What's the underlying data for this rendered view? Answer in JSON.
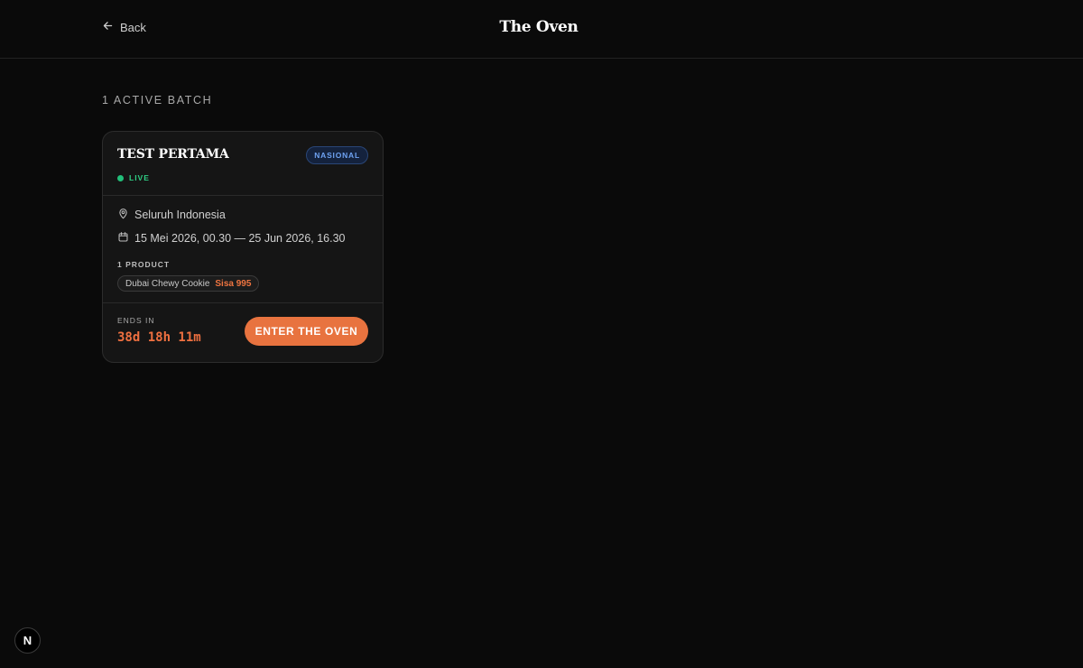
{
  "header": {
    "back_label": "Back",
    "site_title": "The Oven"
  },
  "section": {
    "label": "1 ACTIVE BATCH"
  },
  "batch": {
    "title": "TEST PERTAMA",
    "badge": "NASIONAL",
    "status": "LIVE",
    "location": "Seluruh Indonesia",
    "date_range": "15 Mei 2026, 00.30 — 25 Jun 2026, 16.30",
    "products_label": "1 PRODUCT",
    "products": [
      {
        "name": "Dubai Chewy Cookie",
        "stock": "Sisa 995"
      }
    ],
    "ends_label": "ENDS IN",
    "countdown": "38d 18h 11m",
    "cta_label": "ENTER THE OVEN"
  },
  "dev_indicator": {
    "label": "N"
  },
  "colors": {
    "background": "#0a0a0a",
    "accent": "#e8733f",
    "live": "#22c07a",
    "badge_text": "#6ea2f2"
  }
}
